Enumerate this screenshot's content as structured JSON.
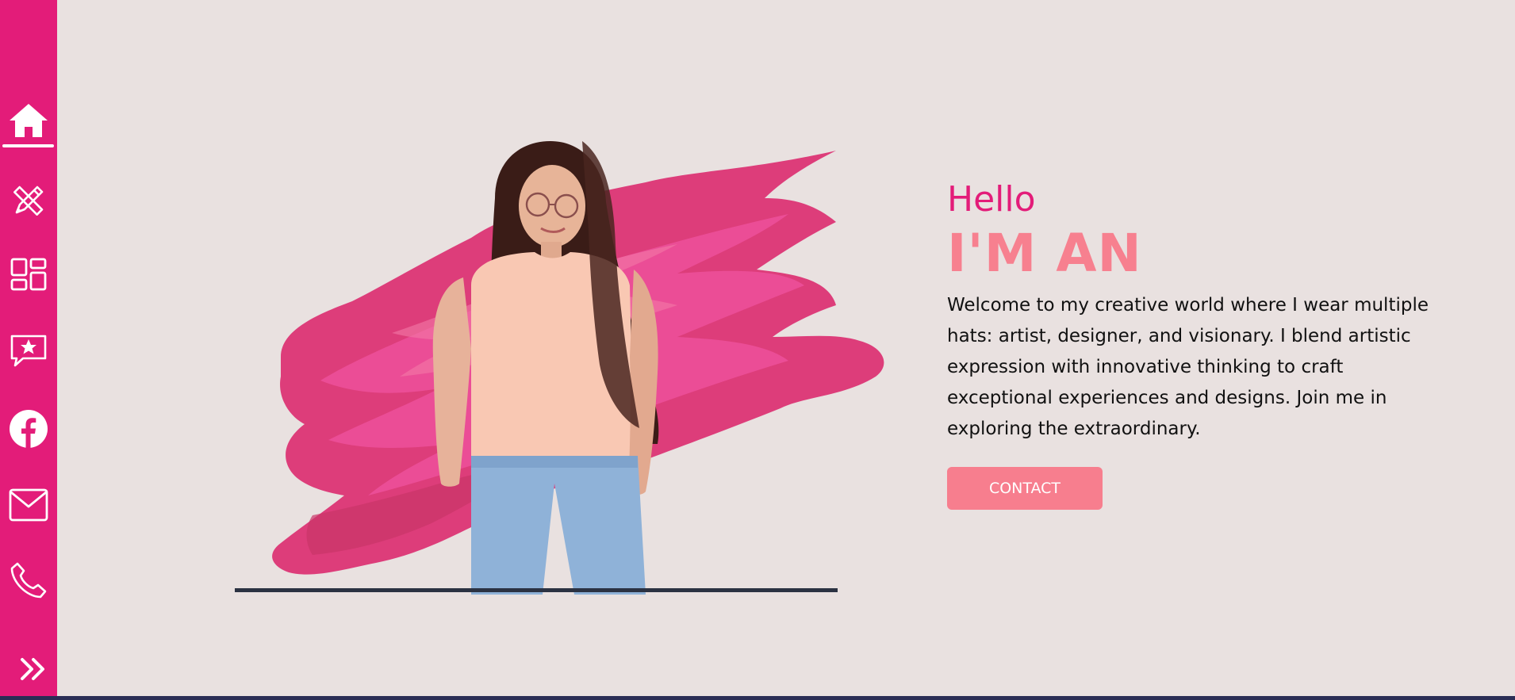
{
  "colors": {
    "sidebar": "#e31c79",
    "background": "#e9e1e0",
    "accent_pink": "#e31c79",
    "headline_pink": "#f7808f",
    "button": "#f77e8e",
    "baseline": "#2b3242"
  },
  "sidebar": {
    "items": [
      {
        "name": "home",
        "icon": "home-icon",
        "active": true
      },
      {
        "name": "skills",
        "icon": "pencil-ruler-icon",
        "active": false
      },
      {
        "name": "portfolio",
        "icon": "dashboard-grid-icon",
        "active": false
      },
      {
        "name": "testimonials",
        "icon": "star-message-icon",
        "active": false
      },
      {
        "name": "facebook",
        "icon": "facebook-icon",
        "active": false
      },
      {
        "name": "email",
        "icon": "mail-icon",
        "active": false
      },
      {
        "name": "phone",
        "icon": "phone-icon",
        "active": false
      }
    ],
    "expand_icon": "double-chevron-right-icon"
  },
  "hero": {
    "greeting": "Hello",
    "headline": "I'M AN",
    "intro": "Welcome to my creative world where I wear multiple hats: artist, designer, and visionary. I blend artistic expression with innovative thinking to craft exceptional experiences and designs. Join me in exploring the extraordinary.",
    "contact_label": "CONTACT",
    "portrait_icon": "person-portrait-image"
  }
}
